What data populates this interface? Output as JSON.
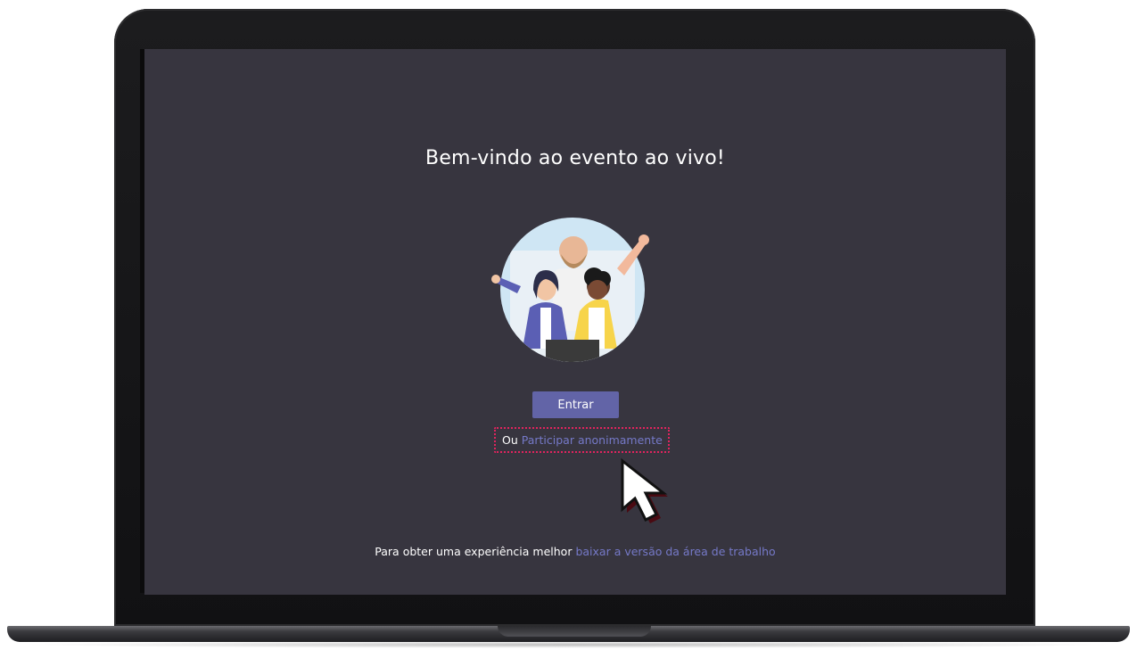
{
  "screen": {
    "title": "Bem-vindo ao evento ao vivo!",
    "enter_button_label": "Entrar",
    "anon_prefix": "Ou",
    "anon_link_label": "Participar anonimamente",
    "footer_text": "Para obter uma experiência melhor",
    "footer_link_label": "baixar a versão da área de trabalho"
  },
  "colors": {
    "screen_background": "#37353f",
    "button_background": "#6264a7",
    "link": "#7579c8",
    "highlight_border": "#e0245e"
  },
  "icons": {
    "illustration": "welcome-people-illustration",
    "cursor": "arrow-cursor-icon"
  }
}
